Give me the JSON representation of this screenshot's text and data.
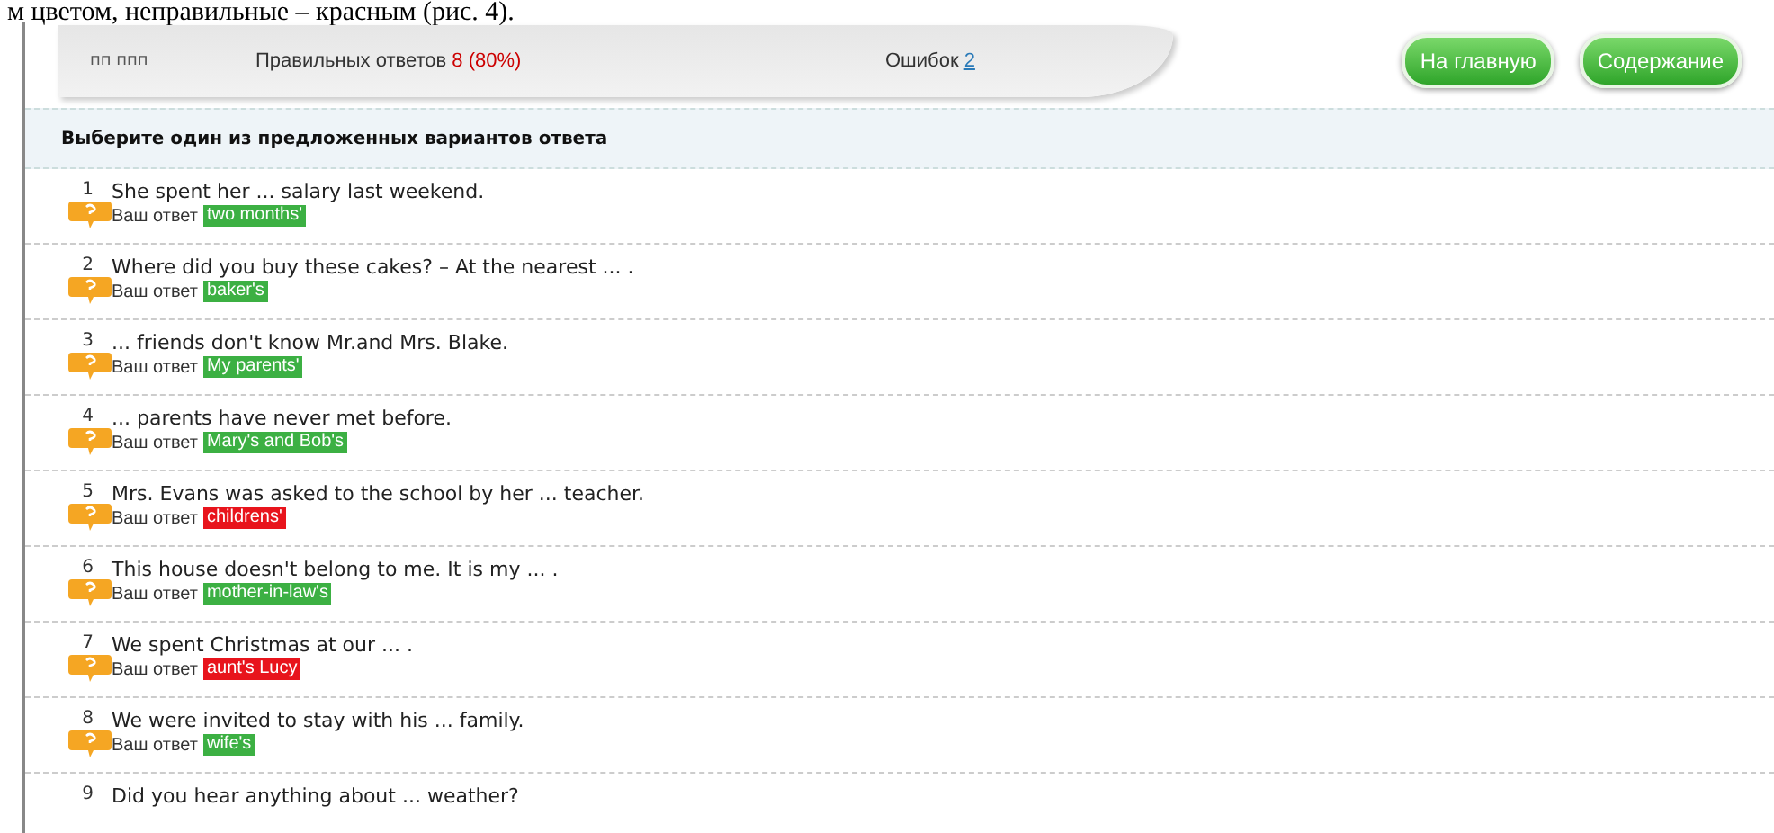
{
  "caption": "м цветом, неправильные – красным (рис. 4).",
  "header": {
    "user": "пп ппп",
    "correct_label": "Правильных ответов",
    "correct_value": "8 (80%)",
    "errors_label": "Ошибок",
    "errors_value": "2"
  },
  "buttons": [
    "На главную",
    "Содержание"
  ],
  "instruction": "Выберите один из предложенных вариантов ответа",
  "questions": [
    {
      "number": "1",
      "text": "She spent her ... salary last weekend.",
      "answer_label": "Ваш ответ",
      "answer": "two months'",
      "correct": true
    },
    {
      "number": "2",
      "text": "Where did you buy these cakes? – At the nearest ... .",
      "answer_label": "Ваш ответ",
      "answer": "baker's",
      "correct": true
    },
    {
      "number": "3",
      "text": "... friends don't know Mr.and Mrs. Blake.",
      "answer_label": "Ваш ответ",
      "answer": "My parents'",
      "correct": true
    },
    {
      "number": "4",
      "text": "... parents have never met before.",
      "answer_label": "Ваш ответ",
      "answer": "Mary's and Bob's",
      "correct": true
    },
    {
      "number": "5",
      "text": "Mrs. Evans was asked to the school by her ... teacher.",
      "answer_label": "Ваш ответ",
      "answer": "childrens'",
      "correct": false
    },
    {
      "number": "6",
      "text": "This house doesn't belong to me. It is my ... .",
      "answer_label": "Ваш ответ",
      "answer": "mother-in-law's",
      "correct": true
    },
    {
      "number": "7",
      "text": "We spent Christmas at our ... .",
      "answer_label": "Ваш ответ",
      "answer": "aunt's Lucy",
      "correct": false
    },
    {
      "number": "8",
      "text": "We were invited to stay with his ... family.",
      "answer_label": "Ваш ответ",
      "answer": "wife's",
      "correct": true
    },
    {
      "number": "9",
      "text": "Did you hear anything about ... weather?"
    }
  ]
}
